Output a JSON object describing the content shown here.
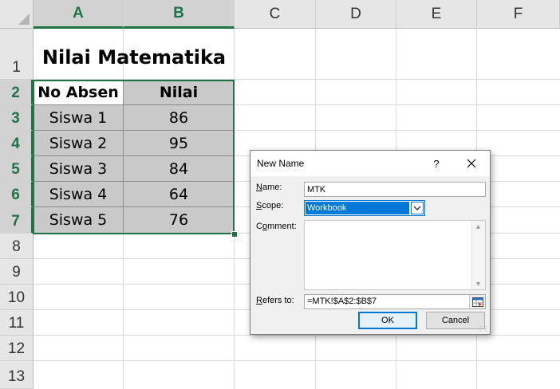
{
  "sheet": {
    "columns": [
      "A",
      "B",
      "C",
      "D",
      "E",
      "F"
    ],
    "rows": [
      "1",
      "2",
      "3",
      "4",
      "5",
      "6",
      "7",
      "8",
      "9",
      "10",
      "11",
      "12",
      "13"
    ],
    "title": "Nilai Matematika",
    "table": {
      "headers": [
        "No Absen",
        "Nilai"
      ],
      "rows": [
        [
          "Siswa 1",
          "86"
        ],
        [
          "Siswa 2",
          "95"
        ],
        [
          "Siswa 3",
          "84"
        ],
        [
          "Siswa 4",
          "64"
        ],
        [
          "Siswa 5",
          "76"
        ]
      ]
    },
    "accent_color": "#217346"
  },
  "dialog": {
    "title": "New Name",
    "help": "?",
    "name_label_key": "N",
    "name_label_rest": "ame:",
    "name_value": "MTK",
    "scope_label_key": "S",
    "scope_label_rest": "cope:",
    "scope_value": "Workbook",
    "comment_label_pre": "C",
    "comment_label_key": "o",
    "comment_label_rest": "mment:",
    "refers_label_key": "R",
    "refers_label_rest": "efers to:",
    "refers_value": "=MTK!$A$2:$B$7",
    "ok_label": "OK",
    "cancel_label": "Cancel",
    "icons": [
      "close-icon",
      "chevron-down-icon",
      "range-picker-icon",
      "resize-grip-icon"
    ]
  }
}
